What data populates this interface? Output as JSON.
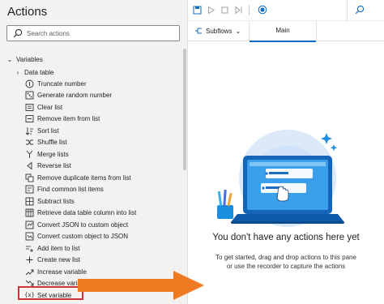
{
  "actions_pane": {
    "title": "Actions",
    "search_placeholder": "Search actions",
    "root_label": "Variables",
    "category_label": "Data table",
    "items": [
      {
        "label": "Truncate number",
        "icon": "truncate-number-icon"
      },
      {
        "label": "Generate random number",
        "icon": "random-number-icon"
      },
      {
        "label": "Clear list",
        "icon": "clear-list-icon"
      },
      {
        "label": "Remove item from list",
        "icon": "remove-item-icon"
      },
      {
        "label": "Sort list",
        "icon": "sort-list-icon"
      },
      {
        "label": "Shuffle list",
        "icon": "shuffle-list-icon"
      },
      {
        "label": "Merge lists",
        "icon": "merge-lists-icon"
      },
      {
        "label": "Reverse list",
        "icon": "reverse-list-icon"
      },
      {
        "label": "Remove duplicate items from list",
        "icon": "remove-duplicates-icon"
      },
      {
        "label": "Find common list items",
        "icon": "find-common-icon"
      },
      {
        "label": "Subtract lists",
        "icon": "subtract-lists-icon"
      },
      {
        "label": "Retrieve data table column into list",
        "icon": "retrieve-column-icon"
      },
      {
        "label": "Convert JSON to custom object",
        "icon": "json-to-object-icon"
      },
      {
        "label": "Convert custom object to JSON",
        "icon": "object-to-json-icon"
      },
      {
        "label": "Add item to list",
        "icon": "add-item-icon"
      },
      {
        "label": "Create new list",
        "icon": "create-list-icon"
      },
      {
        "label": "Increase variable",
        "icon": "increase-variable-icon"
      },
      {
        "label": "Decrease variable",
        "icon": "decrease-variable-icon"
      },
      {
        "label": "Set variable",
        "icon": "set-variable-icon"
      }
    ]
  },
  "designer": {
    "tabs": {
      "subflows_label": "Subflows",
      "main_label": "Main"
    },
    "empty_title": "You don't have any actions here yet",
    "empty_subtitle_line1": "To get started, drag and drop actions to this pane",
    "empty_subtitle_line2": "or use the recorder to capture the actions"
  },
  "colors": {
    "accent": "#0f6cbd",
    "highlight_border": "#d13438",
    "arrow": "#f07a21",
    "pane_bg": "#f3f2f1"
  }
}
